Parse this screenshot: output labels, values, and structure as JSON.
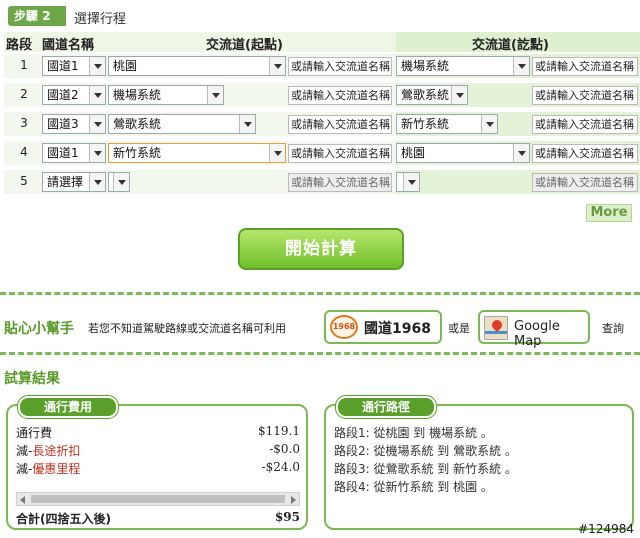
{
  "step": {
    "label": "步驟",
    "number": "2",
    "title": "選擇行程"
  },
  "table": {
    "headers": {
      "segment": "路段",
      "highway": "國道名稱",
      "start": "交流道(起點)",
      "end": "交流道(訖點)"
    },
    "rows": [
      {
        "idx": "1",
        "highway": "國道1",
        "start": "桃園",
        "start_input": "或請輸入交流道名稱",
        "end": "機場系統",
        "end_input": "或請輸入交流道名稱"
      },
      {
        "idx": "2",
        "highway": "國道2",
        "start": "機場系統",
        "start_input": "或請輸入交流道名稱",
        "end": "鶯歌系統",
        "end_input": "或請輸入交流道名稱"
      },
      {
        "idx": "3",
        "highway": "國道3",
        "start": "鶯歌系統",
        "start_input": "或請輸入交流道名稱",
        "end": "新竹系統",
        "end_input": "或請輸入交流道名稱"
      },
      {
        "idx": "4",
        "highway": "國道1",
        "start": "新竹系統",
        "start_input": "或請輸入交流道名稱",
        "end": "桃園",
        "end_input": "或請輸入交流道名稱"
      },
      {
        "idx": "5",
        "highway": "請選擇",
        "start": "",
        "start_input": "或請輸入交流道名稱",
        "end": "",
        "end_input": "或請輸入交流道名稱"
      }
    ]
  },
  "more_label": "More",
  "calc_label": "開始計算",
  "helper": {
    "title": "貼心小幫手",
    "text": "若您不知道駕駛路線或交流道名稱可利用",
    "badge": "1968",
    "link1": "國道1968",
    "or": "或是",
    "link2": "Google Map",
    "query": "查詢"
  },
  "results": {
    "title": "試算結果",
    "cost": {
      "tag": "通行費用",
      "lines": [
        {
          "label": "通行費",
          "value": "$119.1"
        },
        {
          "prefix": "減-",
          "label": "長途折扣",
          "value": "-$0.0"
        },
        {
          "prefix": "減-",
          "label": "優惠里程",
          "value": "-$24.0"
        }
      ],
      "total_label": "合計(四捨五入後)",
      "total_value": "$95"
    },
    "route": {
      "tag": "通行路徑",
      "lines": [
        "路段1: 從桃園 到 機場系統 。",
        "路段2: 從機場系統 到 鶯歌系統 。",
        "路段3: 從鶯歌系統 到 新竹系統 。",
        "路段4: 從新竹系統 到 桃園 。"
      ]
    }
  },
  "watermark": "#124984"
}
